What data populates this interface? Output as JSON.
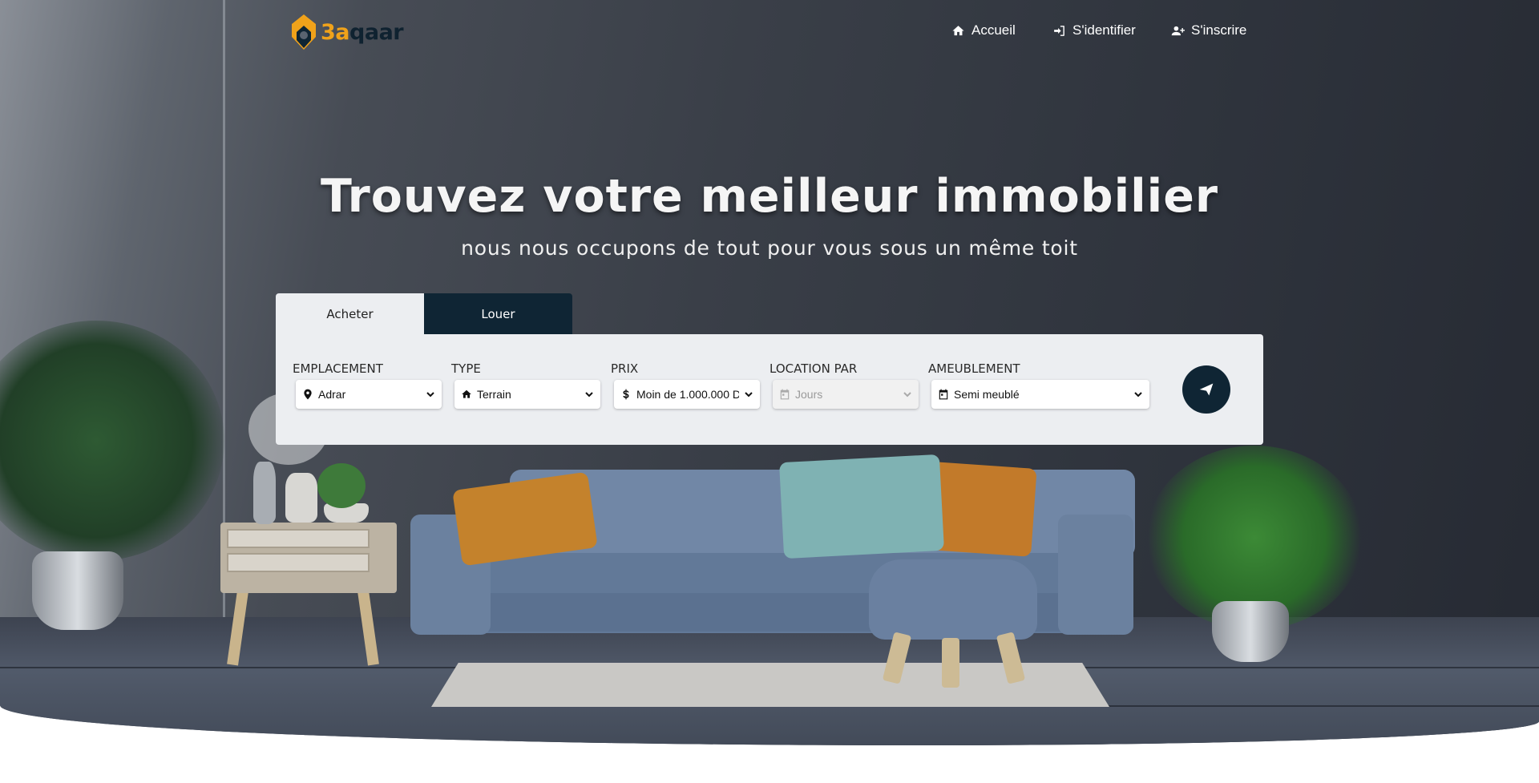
{
  "brand": {
    "prefix": "3a",
    "suffix": "qaar"
  },
  "nav": {
    "home": "Accueil",
    "login": "S'identifier",
    "signup": "S'inscrire"
  },
  "hero": {
    "title": "Trouvez votre meilleur immobilier",
    "subtitle": "nous nous occupons de tout pour vous sous un même toit"
  },
  "search": {
    "tabs": {
      "buy": "Acheter",
      "rent": "Louer"
    },
    "active_tab": "Acheter",
    "fields": {
      "location": {
        "label": "EMPLACEMENT",
        "value": "Adrar",
        "icon": "map-marker-icon"
      },
      "type": {
        "label": "TYPE",
        "value": "Terrain",
        "icon": "home-icon"
      },
      "price": {
        "label": "PRIX",
        "value": "Moin de 1.000.000 D",
        "icon": "dollar-icon"
      },
      "rent_by": {
        "label": "LOCATION PAR",
        "value": "Jours",
        "icon": "calendar-icon",
        "disabled": true
      },
      "furnishing": {
        "label": "AMEUBLEMENT",
        "value": "Semi meublé",
        "icon": "calendar-icon"
      }
    },
    "submit_icon": "paper-plane-icon"
  },
  "colors": {
    "brand_dark": "#0f2534",
    "brand_accent": "#f0a21a",
    "panel_bg": "#eceef1"
  }
}
